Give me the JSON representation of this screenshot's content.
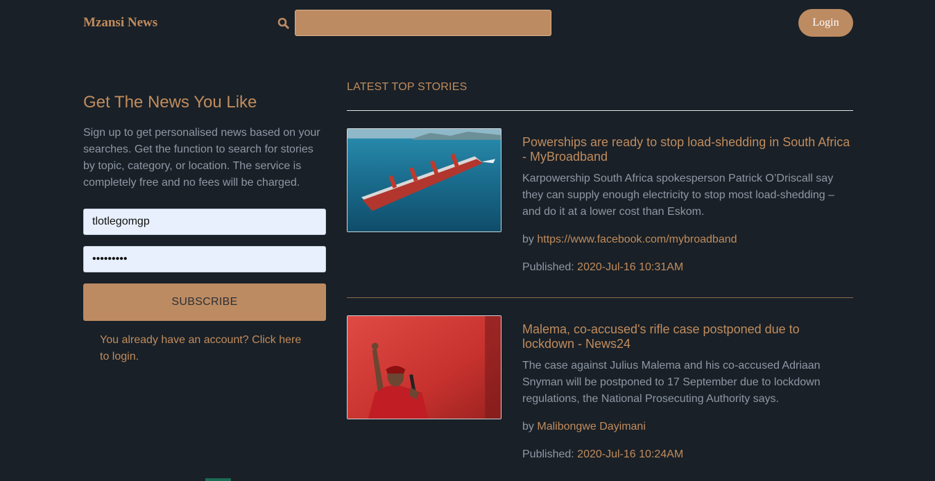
{
  "header": {
    "brand": "Mzansi News",
    "search": {
      "value": "",
      "placeholder": "",
      "icon": "search-icon"
    },
    "login_label": "Login"
  },
  "signup": {
    "heading": "Get The News You Like",
    "intro": "Sign up to get personalised news based on your searches. Get the function to search for stories by topic, category, or location. The service is completely free and no fees will be charged.",
    "username_value": "tlotlegomgp",
    "password_value": "•••••••••",
    "subscribe_label": "SUBSCRIBE",
    "account_link": "You already have an account? Click here to login."
  },
  "stories_section": {
    "title": "LATEST TOP STORIES",
    "stories": [
      {
        "title": "Powerships are ready to stop load-shedding in South Africa - MyBroadband",
        "summary": "Karpowership South Africa spokesperson Patrick O’Driscall say they can supply enough electricity to stop most load-shedding – and do it at a lower cost than Eskom.",
        "by_label": "by",
        "author": "https://www.facebook.com/mybroadband",
        "published_label": "Published:",
        "published": "2020-Jul-16 10:31AM",
        "image": "powership-ship-photo"
      },
      {
        "title": "Malema, co-accused's rifle case postponed due to lockdown - News24",
        "summary": "The case against Julius Malema and his co-accused Adriaan Snyman will be postponed to 17 September due to lockdown regulations, the National Prosecuting Authority says.",
        "by_label": "by",
        "author": "Malibongwe Dayimani",
        "published_label": "Published:",
        "published": "2020-Jul-16 10:24AM",
        "image": "speaker-red-background-photo"
      }
    ]
  },
  "colors": {
    "background": "#192027",
    "accent": "#c18c5d",
    "accent_fill": "#bd8b62",
    "muted_text": "#8e98a5",
    "input_fill": "#e8f0fe"
  }
}
